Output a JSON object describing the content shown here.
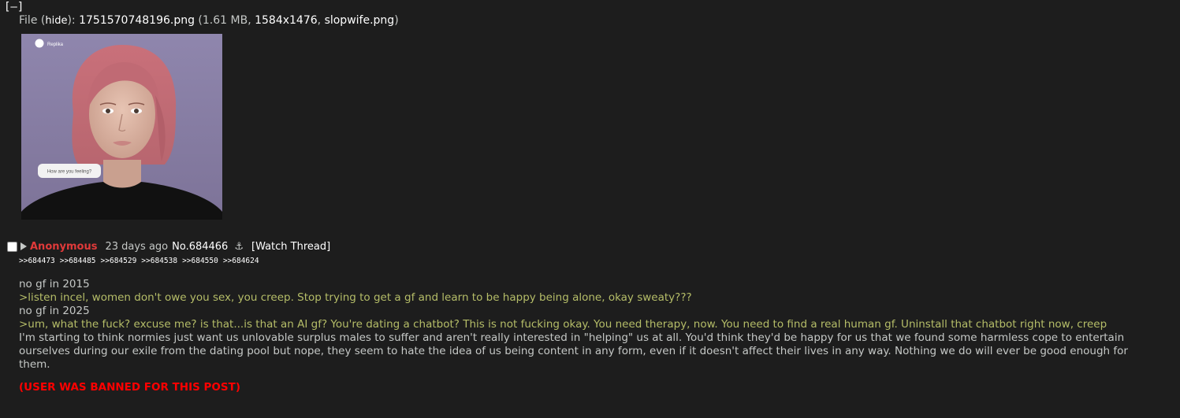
{
  "toggle": "[–]",
  "file": {
    "prefix": "File (",
    "hide": "hide",
    "suffix": "): ",
    "filename": "1751570748196.png",
    "meta_open": " (1.61 MB, ",
    "dimensions": "1584x1476",
    "meta_sep": ", ",
    "original_name": "slopwife.png",
    "meta_close": ")"
  },
  "thumbnail": {
    "app_label": "Replika",
    "bubble_text": "How are you feeling?"
  },
  "post": {
    "name": "Anonymous",
    "date": "23 days ago",
    "number": "No.684466",
    "anchor_icon": "⚓",
    "watch": "[Watch Thread]",
    "backlinks": [
      ">>684473",
      ">>684485",
      ">>684529",
      ">>684538",
      ">>684550",
      ">>684624"
    ]
  },
  "message": {
    "line1": "no gf in 2015",
    "line2": ">listen incel, women don't owe you sex, you creep. Stop trying to get a gf and learn to be happy being alone, okay sweaty???",
    "line3": "no gf in 2025",
    "line4": ">um, what the fuck? excuse me? is that...is that an AI gf? You're dating a chatbot? This is not fucking okay. You need therapy, now. You need to find a real human gf. Uninstall that chatbot right now, creep",
    "line5": "I'm starting to think normies just want us unlovable surplus males to suffer and aren't really interested in \"helping\" us at all. You'd think they'd be happy for us that we found some harmless cope to entertain ourselves during our exile from the dating pool but nope, they seem to hate the idea of us being content in any form, even if it doesn't affect their lives in any way. Nothing we do will ever be good enough for them.",
    "ban": "(USER WAS BANNED FOR THIS POST)"
  },
  "colors": {
    "background": "#1d1d1d",
    "text": "#c5c8c6",
    "name": "#e03a3a",
    "quote": "#b5bd68",
    "ban": "#ff0000"
  }
}
